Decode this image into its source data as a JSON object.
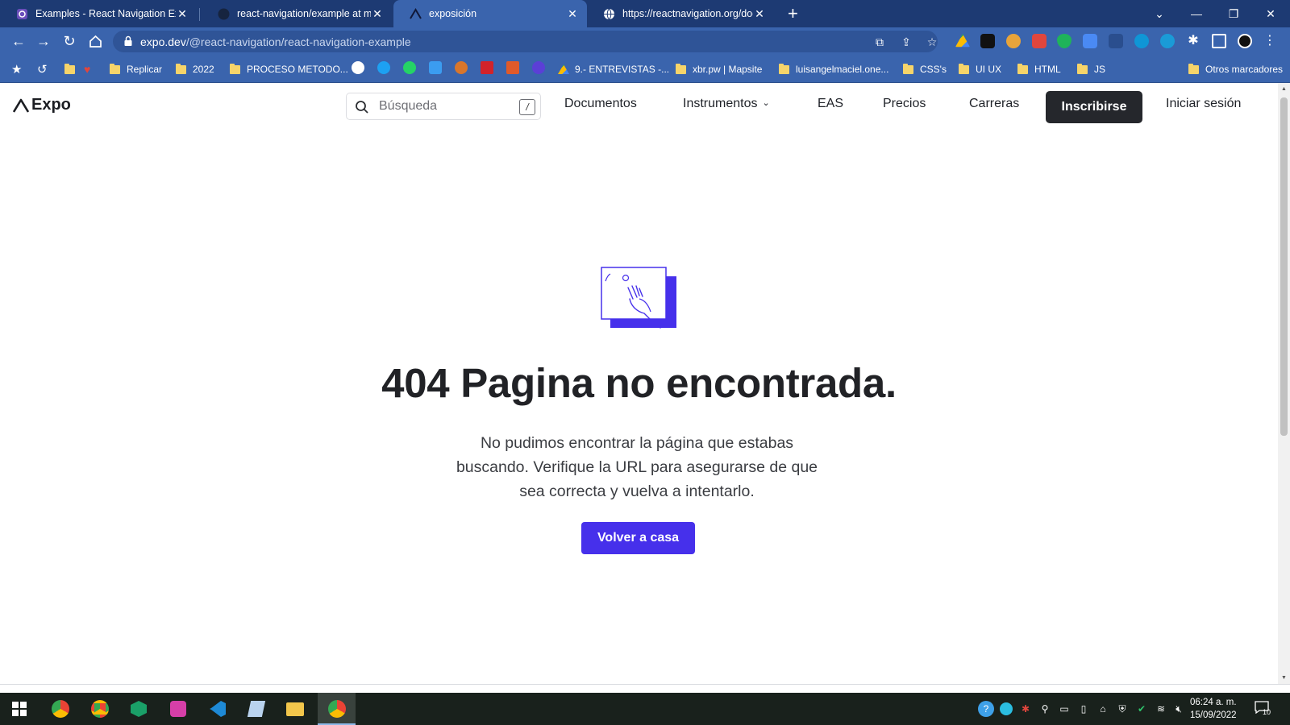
{
  "browser": {
    "tabs": [
      {
        "title": "Examples - React Navigation Exa",
        "icon": "react-navigation-icon"
      },
      {
        "title": "react-navigation/example at mai",
        "icon": "github-icon"
      },
      {
        "title": "exposición",
        "icon": "expo-icon"
      },
      {
        "title": "https://reactnavigation.org/docs/",
        "icon": "globe-icon"
      }
    ],
    "active_tab_index": 2,
    "url_host": "expo.dev",
    "url_path": "/@react-navigation/react-navigation-example",
    "bookmarks": [
      {
        "label": "Replicar"
      },
      {
        "label": "2022"
      },
      {
        "label": "PROCESO METODO..."
      },
      {
        "label": "9.- ENTREVISTAS -..."
      },
      {
        "label": "xbr.pw | Mapsite"
      },
      {
        "label": "luisangelmaciel.one..."
      },
      {
        "label": "CSS's"
      },
      {
        "label": "UI UX"
      },
      {
        "label": "HTML"
      },
      {
        "label": "JS"
      },
      {
        "label": "Otros marcadores"
      }
    ]
  },
  "header": {
    "logo_text": "Expo",
    "search_placeholder": "Búsqueda",
    "search_shortcut": "/",
    "nav": {
      "docs": "Documentos",
      "tools": "Instrumentos",
      "eas": "EAS",
      "pricing": "Precios",
      "careers": "Carreras",
      "signup": "Inscribirse",
      "login": "Iniciar sesión"
    }
  },
  "main": {
    "title": "404 Pagina no encontrada.",
    "description": "No pudimos encontrar la página que estabas buscando. Verifique la URL para asegurarse de que sea correcta y vuelva a intentarlo.",
    "cta": "Volver a casa",
    "accent_color": "#4630eb"
  },
  "taskbar": {
    "clock_time": "06:24 a. m.",
    "clock_date": "15/09/2022",
    "notification_count": "10"
  }
}
